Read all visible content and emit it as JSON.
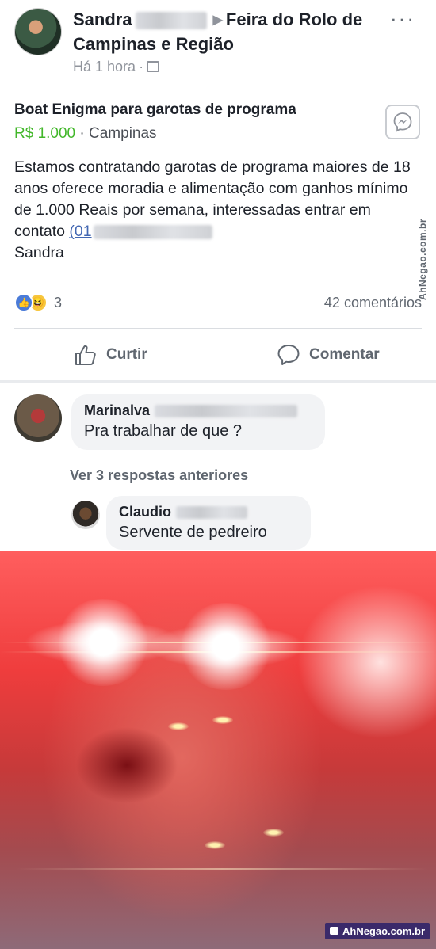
{
  "post": {
    "author": "Sandra",
    "group": "Feira do Rolo de Campinas e Região",
    "time": "Há 1 hora",
    "title": "Boat Enigma para garotas de programa",
    "price": "R$ 1.000",
    "location": "Campinas",
    "body": "Estamos contratando garotas de programa maiores de 18 anos oferece moradia e alimentação com ganhos mínimo de 1.000 Reais por semana, interessadas entrar em contato",
    "phone_prefix": "(01",
    "signature": "Sandra",
    "reaction_count": "3",
    "comment_count": "42 comentários",
    "like_label": "Curtir",
    "comment_label": "Comentar"
  },
  "comments": {
    "first": {
      "name": "Marinalva",
      "text": "Pra trabalhar de que ?"
    },
    "view_replies": "Ver 3 respostas anteriores",
    "reply": {
      "name": "Claudio",
      "text": "Servente de pedreiro"
    }
  },
  "watermark": {
    "side": "AhNegao.com.br",
    "corner": "AhNegao.com.br"
  },
  "colors": {
    "link": "#4267b2",
    "price": "#42b72a",
    "muted": "#606770"
  }
}
